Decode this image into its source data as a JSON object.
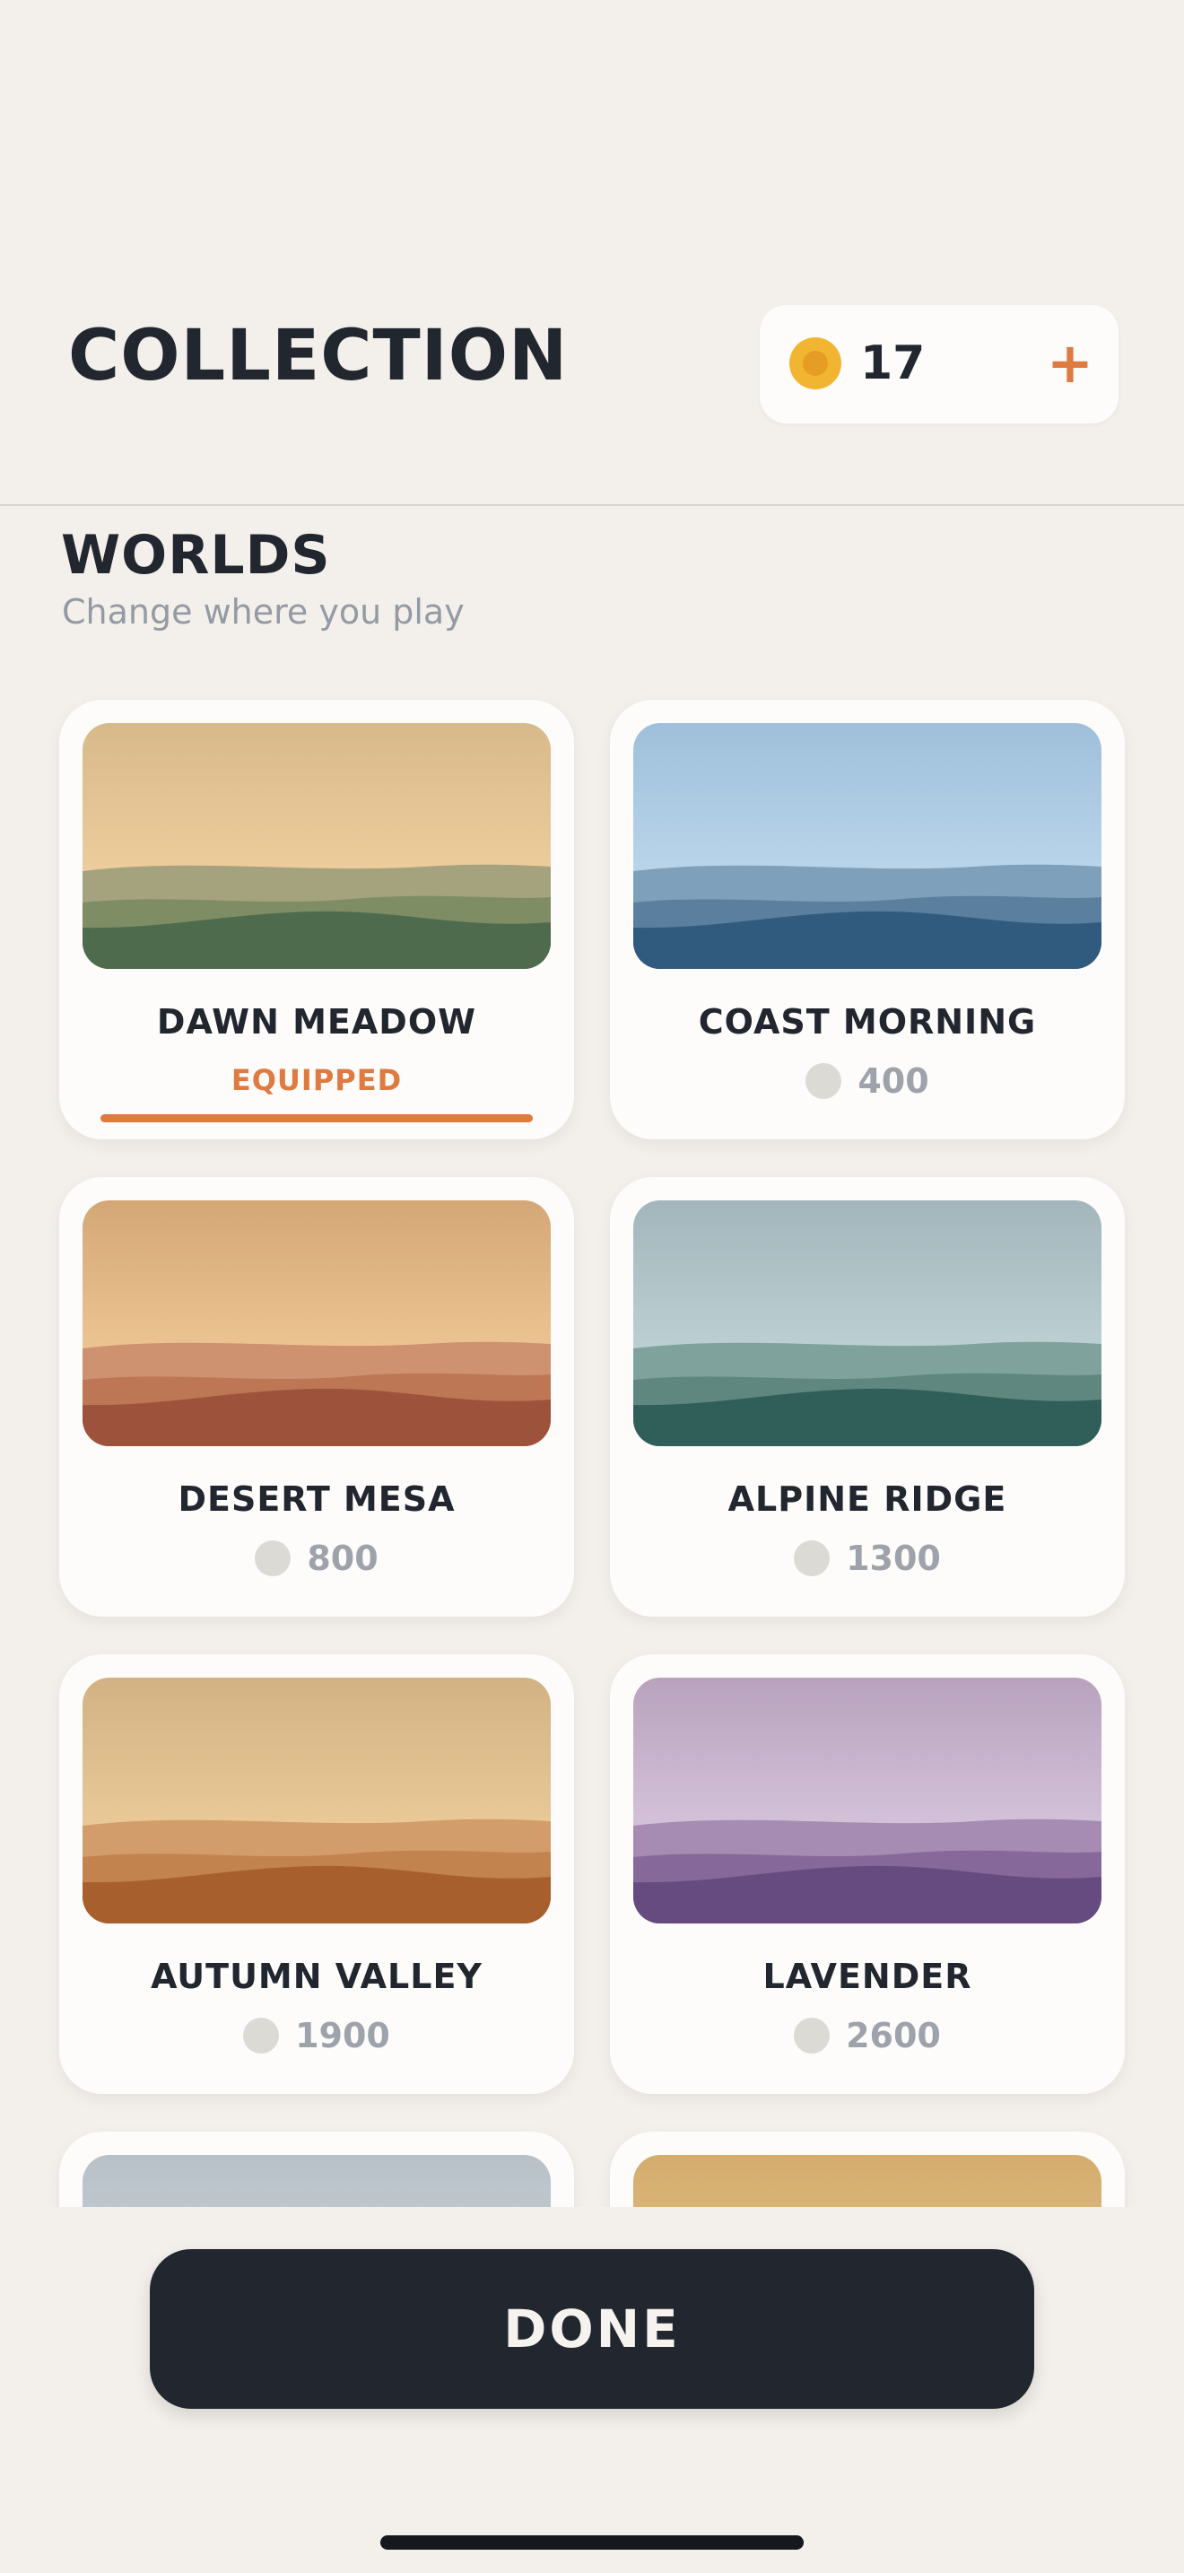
{
  "header": {
    "title": "COLLECTION",
    "coins": "17",
    "add_label": "+",
    "coin_icon": "coin-icon"
  },
  "section": {
    "title": "WORLDS",
    "subtitle": "Change where you play"
  },
  "colors": {
    "accent": "#df7a40",
    "dark": "#21262f",
    "background": "#f3f0eb",
    "card": "#fdfcfa",
    "muted": "#9ea3ab"
  },
  "worlds": [
    {
      "name": "DAWN MEADOW",
      "status": "EQUIPPED",
      "equipped": true,
      "sky": [
        "#d8b98a",
        "#fcd9a8"
      ],
      "layers": [
        "#a5a27e",
        "#7f8d65",
        "#4f6b4d"
      ]
    },
    {
      "name": "COAST MORNING",
      "price": "400",
      "equipped": false,
      "sky": [
        "#9fbfda",
        "#c9e3f5"
      ],
      "layers": [
        "#7ea0bb",
        "#5b7f9e",
        "#315b7e"
      ]
    },
    {
      "name": "DESERT MESA",
      "price": "800",
      "equipped": false,
      "sky": [
        "#d4a776",
        "#fbd7a4"
      ],
      "layers": [
        "#cf9270",
        "#bd7755",
        "#9d533b"
      ]
    },
    {
      "name": "ALPINE RIDGE",
      "price": "1300",
      "equipped": false,
      "sky": [
        "#a2b6bb",
        "#cde0e3"
      ],
      "layers": [
        "#7fa39c",
        "#5f877f",
        "#2f5f58"
      ]
    },
    {
      "name": "AUTUMN VALLEY",
      "price": "1900",
      "equipped": false,
      "sky": [
        "#d2b183",
        "#fad9a6"
      ],
      "layers": [
        "#d29d6a",
        "#c3834e",
        "#a75f2e"
      ]
    },
    {
      "name": "LAVENDER",
      "price": "2600",
      "equipped": false,
      "sky": [
        "#b8a2bd",
        "#e6d6ec"
      ],
      "layers": [
        "#a68cb2",
        "#86699a",
        "#654b7f"
      ]
    },
    {
      "name": "",
      "price": "",
      "equipped": false,
      "sky": [
        "#b8c0c8",
        "#d6dce2"
      ],
      "layers": [
        "#9aa3ad",
        "#7d8792",
        "#5c6671"
      ]
    },
    {
      "name": "",
      "price": "",
      "equipped": false,
      "sky": [
        "#d4ad6e",
        "#ecca92"
      ],
      "layers": [
        "#c99a57",
        "#b27d3e",
        "#8f5e29"
      ]
    }
  ],
  "footer": {
    "done_label": "DONE"
  }
}
